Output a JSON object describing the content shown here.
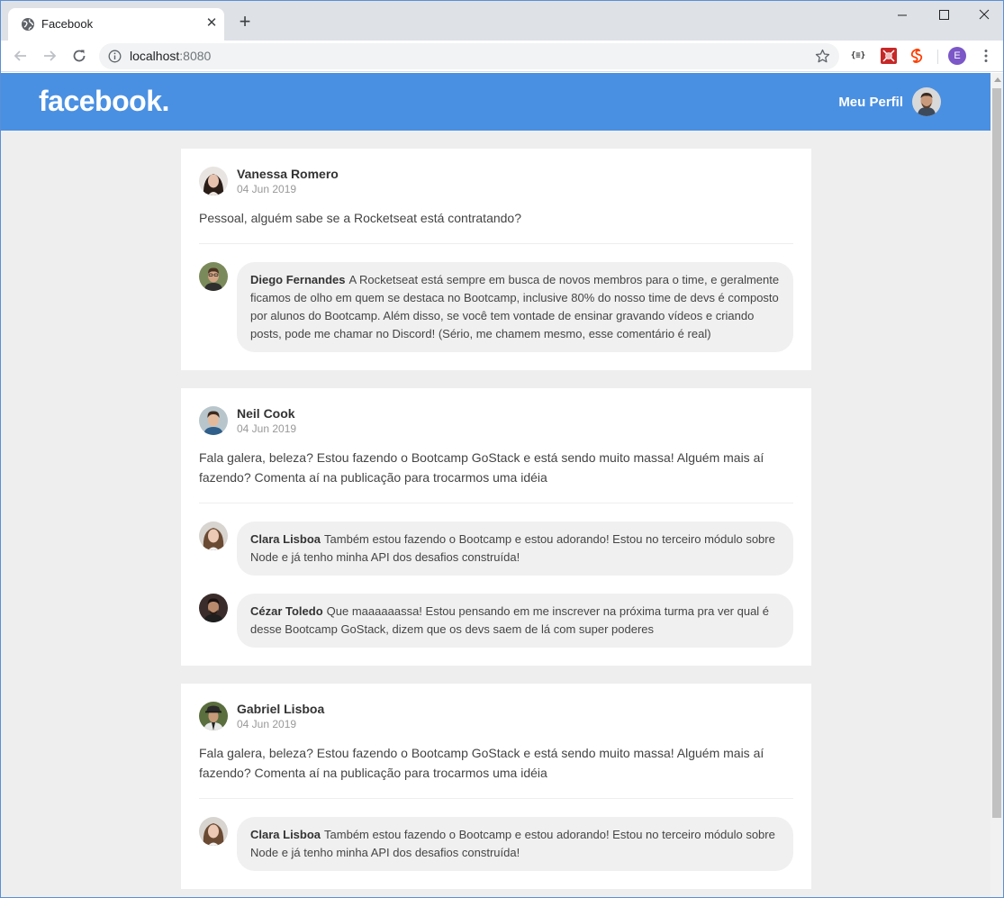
{
  "browser": {
    "tab_title": "Facebook",
    "url_host": "localhost",
    "url_port": ":8080",
    "extensions": {
      "json_label": "{≡}"
    },
    "profile_initial": "E"
  },
  "header": {
    "logo": "facebook.",
    "profile_label": "Meu Perfil"
  },
  "colors": {
    "header_bg": "#4a90e2",
    "page_bg": "#eeeeee",
    "bubble_bg": "#f0f0f0"
  },
  "posts": [
    {
      "author": "Vanessa Romero",
      "date": "04 Jun 2019",
      "content": "Pessoal, alguém sabe se a Rocketseat está contratando?",
      "comments": [
        {
          "author": "Diego Fernandes",
          "content": "A Rocketseat está sempre em busca de novos membros para o time, e geralmente ficamos de olho em quem se destaca no Bootcamp, inclusive 80% do nosso time de devs é composto por alunos do Bootcamp. Além disso, se você tem vontade de ensinar gravando vídeos e criando posts, pode me chamar no Discord! (Sério, me chamem mesmo, esse comentário é real)"
        }
      ]
    },
    {
      "author": "Neil Cook",
      "date": "04 Jun 2019",
      "content": "Fala galera, beleza? Estou fazendo o Bootcamp GoStack e está sendo muito massa! Alguém mais aí fazendo? Comenta aí na publicação para trocarmos uma idéia",
      "comments": [
        {
          "author": "Clara Lisboa",
          "content": "Também estou fazendo o Bootcamp e estou adorando! Estou no terceiro módulo sobre Node e já tenho minha API dos desafios construída!"
        },
        {
          "author": "Cézar Toledo",
          "content": "Que maaaaaassa! Estou pensando em me inscrever na próxima turma pra ver qual é desse Bootcamp GoStack, dizem que os devs saem de lá com super poderes"
        }
      ]
    },
    {
      "author": "Gabriel Lisboa",
      "date": "04 Jun 2019",
      "content": "Fala galera, beleza? Estou fazendo o Bootcamp GoStack e está sendo muito massa! Alguém mais aí fazendo? Comenta aí na publicação para trocarmos uma idéia",
      "comments": [
        {
          "author": "Clara Lisboa",
          "content": "Também estou fazendo o Bootcamp e estou adorando! Estou no terceiro módulo sobre Node e já tenho minha API dos desafios construída!"
        }
      ]
    }
  ]
}
